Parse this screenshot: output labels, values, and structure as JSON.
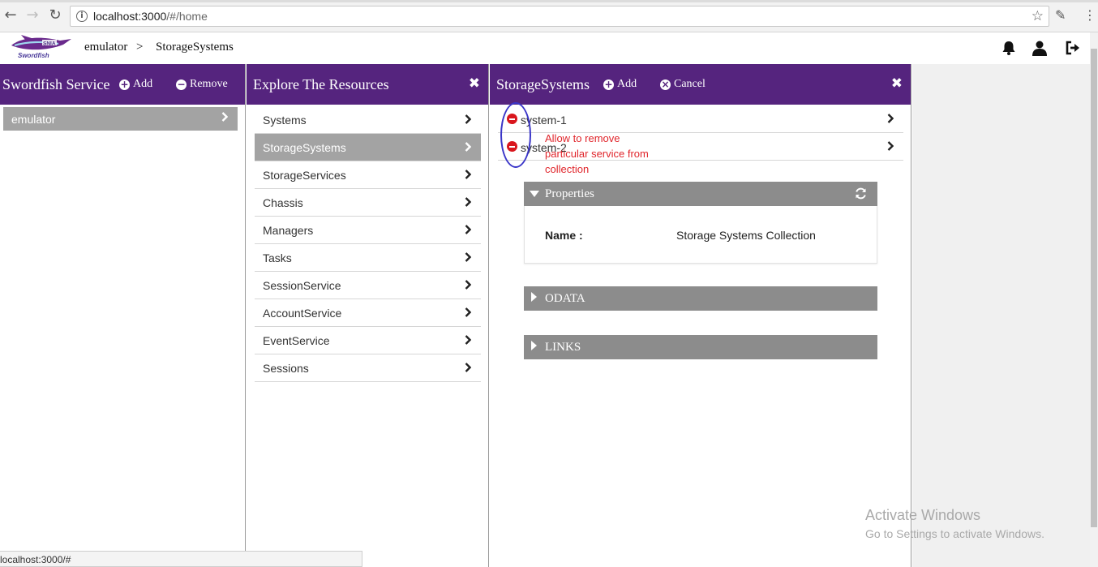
{
  "browser": {
    "url_host": "localhost:3000",
    "url_path": "/#/home",
    "status_url": "localhost:3000/#"
  },
  "header": {
    "logo_text_top": "SNIA",
    "logo_text_bottom": "Swordfish",
    "breadcrumb": [
      "emulator",
      ">",
      "StorageSystems"
    ]
  },
  "service_panel": {
    "title": "Swordfish Service",
    "add_label": "Add",
    "remove_label": "Remove",
    "items": [
      {
        "label": "emulator"
      }
    ]
  },
  "explore_panel": {
    "title": "Explore The Resources",
    "items": [
      {
        "label": "Systems"
      },
      {
        "label": "StorageSystems",
        "active": true
      },
      {
        "label": "StorageServices"
      },
      {
        "label": "Chassis"
      },
      {
        "label": "Managers"
      },
      {
        "label": "Tasks"
      },
      {
        "label": "SessionService"
      },
      {
        "label": "AccountService"
      },
      {
        "label": "EventService"
      },
      {
        "label": "Sessions"
      }
    ]
  },
  "storage_panel": {
    "title": "StorageSystems",
    "add_label": "Add",
    "cancel_label": "Cancel",
    "systems": [
      {
        "label": "system-1"
      },
      {
        "label": "system-2"
      }
    ],
    "annotation": "Allow to remove particular service from collection",
    "properties": {
      "header": "Properties",
      "name_label": "Name :",
      "name_value": "Storage Systems Collection"
    },
    "odata_header": "ODATA",
    "links_header": "LINKS"
  },
  "watermark": {
    "line1": "Activate Windows",
    "line2": "Go to Settings to activate Windows."
  },
  "colors": {
    "panel_header": "#55247e",
    "selected_item": "#a3a3a3",
    "accordion_header": "#8c8c8c",
    "remove_icon": "#d9161d",
    "annotation_ellipse": "#3a35c8",
    "annotation_text": "#e0252b"
  }
}
